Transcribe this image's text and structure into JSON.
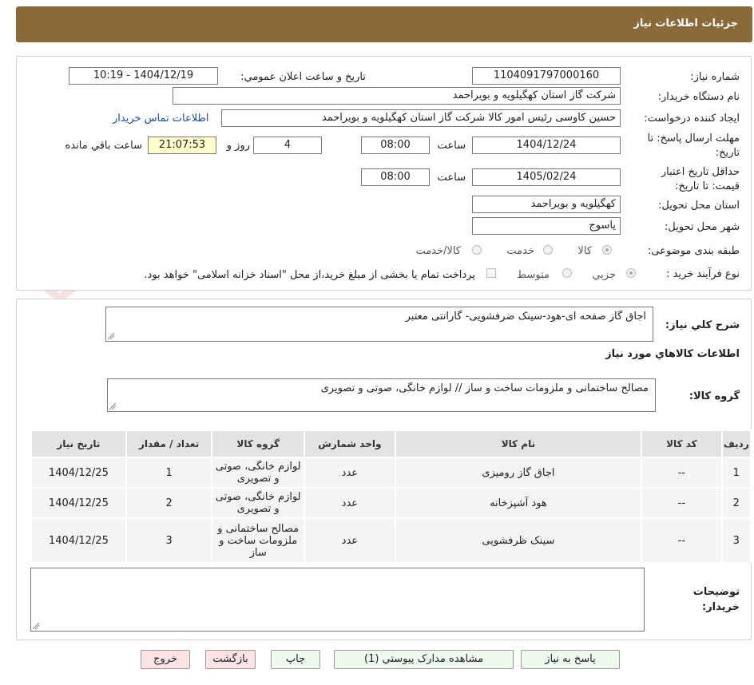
{
  "header": {
    "title": "جزئیات اطلاعات نیاز"
  },
  "watermark": {
    "text": "AriaTender.neT"
  },
  "form": {
    "need_number": {
      "label": "شماره نیاز:",
      "value": "1104091797000160"
    },
    "announce_datetime": {
      "label": "تاریخ و ساعت اعلان عمومي:",
      "value": "1404/12/19 - 10:19"
    },
    "buyer_org": {
      "label": "نام دستگاه خريدار:",
      "value": "شرکت گاز استان کهگیلویه و بویراحمد"
    },
    "requester": {
      "label": "ايجاد کننده درخواست:",
      "value": "حسین کاوسی رئیس امور کالا شرکت گاز استان کهگیلویه و بویراحمد",
      "contact_link": "اطلاعات تماس خريدار"
    },
    "reply_deadline": {
      "label": "مهلت ارسال پاسخ: تا تاریخ:",
      "date": "1404/12/24",
      "time_label": "ساعت",
      "time": "08:00",
      "days": "4",
      "days_label": "روز و",
      "remaining": "21:07:53",
      "remaining_label": "ساعت باقي مانده"
    },
    "price_validity": {
      "label": "حداقل تاريخ اعتبار قيمت: تا تاريخ:",
      "date": "1405/02/24",
      "time_label": "ساعت",
      "time": "08:00"
    },
    "delivery_province": {
      "label": "استان محل تحويل:",
      "value": "کهگیلویه و بویراحمد"
    },
    "delivery_city": {
      "label": "شهر محل تحويل:",
      "value": "یاسوج"
    },
    "category": {
      "label": "طبقه بندی موضوعی:",
      "options": [
        "کالا",
        "خدمت",
        "کالا/خدمت"
      ],
      "selected": "کالا"
    },
    "purchase_type": {
      "label": "نوع فرآيند خريد :",
      "options": [
        "جزيي",
        "متوسط"
      ],
      "selected": "جزيي",
      "note": "پرداخت تمام یا بخشی از مبلغ خرید،از محل \"اسناد خزانه اسلامی\" خواهد بود."
    }
  },
  "summary": {
    "label": "شرح کلي نياز:",
    "value": "اجاق گاز صفحه ای-هود-سینک ضرفشویی- گارانتی معتبر",
    "goods_info_title": "اطلاعات کالاهاي مورد نياز",
    "group_label": "گروه کالا:",
    "group_value": "مصالح ساختمانی و ملزومات ساخت و ساز // لوازم خانگی، صوتی و تصویری"
  },
  "table": {
    "headers": [
      "رديف",
      "کد کالا",
      "نام کالا",
      "واحد شمارش",
      "گروه کالا",
      "تعداد / مقدار",
      "تاريخ نياز"
    ],
    "rows": [
      [
        "1",
        "--",
        "اجاق گاز رومیزی",
        "عدد",
        "لوازم خانگی، صوتی و تصویری",
        "1",
        "1404/12/25"
      ],
      [
        "2",
        "--",
        "هود آشپزخانه",
        "عدد",
        "لوازم خانگی، صوتی و تصویری",
        "2",
        "1404/12/25"
      ],
      [
        "3",
        "--",
        "سینک ظرفشویی",
        "عدد",
        "مصالح ساختمانی و ملزومات ساخت و ساز",
        "3",
        "1404/12/25"
      ]
    ]
  },
  "buyer_notes": {
    "label": "توضيحات خريدار:",
    "value": ""
  },
  "buttons": {
    "reply": "پاسخ به نياز",
    "attachments": "مشاهده مدارک پيوستي (1)",
    "print": "چاپ",
    "back": "بازگشت",
    "exit": "خروج"
  },
  "colors": {
    "header_bg": "#8b6a3a",
    "link": "#1a4fa0",
    "remaining_bg": "#ffffcc",
    "button_green": "#eefaee",
    "button_pink": "#fde4e4"
  }
}
